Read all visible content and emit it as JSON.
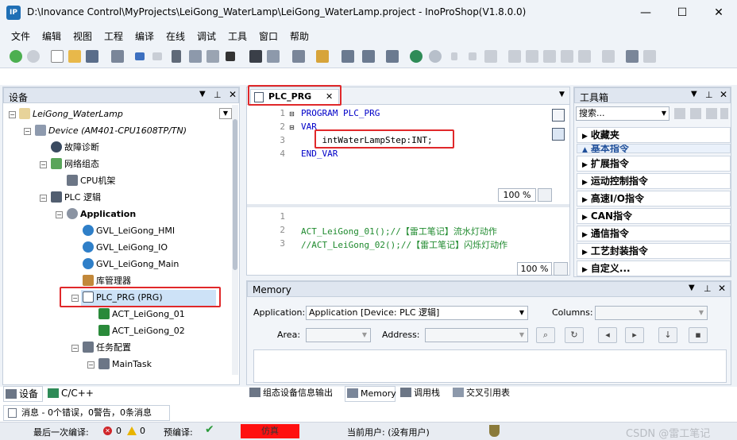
{
  "window": {
    "icon_label": "IP",
    "title": "D:\\Inovance Control\\MyProjects\\LeiGong_WaterLamp\\LeiGong_WaterLamp.project - InoProShop(V1.8.0.0)",
    "min": "—",
    "max": "☐",
    "close": "✕"
  },
  "menu": [
    "文件",
    "编辑",
    "视图",
    "工程",
    "编译",
    "在线",
    "调试",
    "工具",
    "窗口",
    "帮助"
  ],
  "device_panel": {
    "title": "设备",
    "tree": [
      "LeiGong_WaterLamp",
      "Device (AM401-CPU1608TP/TN)",
      "故障诊断",
      "网络组态",
      "CPU机架",
      "PLC 逻辑",
      "Application",
      "GVL_LeiGong_HMI",
      "GVL_LeiGong_IO",
      "GVL_LeiGong_Main",
      "库管理器",
      "PLC_PRG (PRG)",
      "ACT_LeiGong_01",
      "ACT_LeiGong_02",
      "任务配置",
      "MainTask"
    ],
    "tabs": [
      "设备",
      "C/C++"
    ]
  },
  "editor": {
    "tab": "PLC_PRG",
    "decl_lines": [
      {
        "n": "1",
        "text": "PROGRAM PLC_PRG"
      },
      {
        "n": "2",
        "text": "VAR"
      },
      {
        "n": "3",
        "text": "    intWaterLampStep:INT;"
      },
      {
        "n": "4",
        "text": "END_VAR"
      }
    ],
    "impl_lines": [
      {
        "n": "1",
        "text": ""
      },
      {
        "n": "2",
        "text": "ACT_LeiGong_01();//【雷工笔记】流水灯动作"
      },
      {
        "n": "3",
        "text": "//ACT_LeiGong_02();//【雷工笔记】闪烁灯动作"
      }
    ],
    "zoom_top": "100 %",
    "zoom_bottom": "100 %"
  },
  "toolbox": {
    "title": "工具箱",
    "search_value": "搜索...",
    "items": [
      "收藏夹",
      "基本指令",
      "扩展指令",
      "运动控制指令",
      "高速I/O指令",
      "CAN指令",
      "通信指令",
      "工艺封装指令",
      "自定义..."
    ]
  },
  "memory": {
    "title": "Memory",
    "application_label": "Application:",
    "application_value": "Application [Device: PLC 逻辑]",
    "columns_label": "Columns:",
    "area_label": "Area:",
    "address_label": "Address:"
  },
  "bottom_tabs": [
    "组态设备信息输出",
    "Memory",
    "调用栈",
    "交叉引用表"
  ],
  "messages_tab": "消息 - 0个错误，0警告，0条消息",
  "status": {
    "last_compile_label": "最后一次编译:",
    "errors": "0",
    "warnings": "0",
    "precompile_label": "预编译:",
    "precompile_mark": "✔",
    "mode": "仿真",
    "user": "当前用户: (没有用户)",
    "watermark": "CSDN @雷工笔记"
  }
}
